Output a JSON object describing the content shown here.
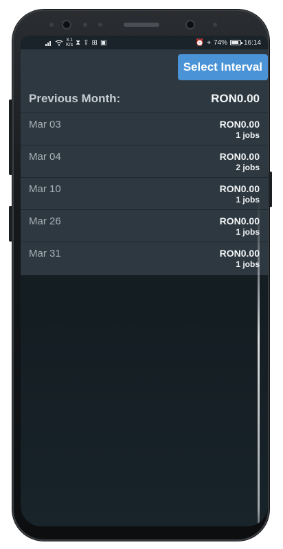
{
  "status_bar": {
    "net_speed_value": "3.1",
    "net_speed_unit": "K/s",
    "battery_percent": "74%",
    "battery_level": 0.74,
    "time": "16:14"
  },
  "toolbar": {
    "select_interval_label": "Select Interval"
  },
  "summary": {
    "label": "Previous Month:",
    "total": "RON0.00"
  },
  "rows": [
    {
      "date": "Mar 03",
      "amount": "RON0.00",
      "jobs": "1 jobs"
    },
    {
      "date": "Mar 04",
      "amount": "RON0.00",
      "jobs": "2 jobs"
    },
    {
      "date": "Mar 10",
      "amount": "RON0.00",
      "jobs": "1 jobs"
    },
    {
      "date": "Mar 26",
      "amount": "RON0.00",
      "jobs": "1 jobs"
    },
    {
      "date": "Mar 31",
      "amount": "RON0.00",
      "jobs": "1 jobs"
    }
  ],
  "colors": {
    "accent": "#4a93d6",
    "card": "#2d3840",
    "screen_bg": "#141d22"
  }
}
